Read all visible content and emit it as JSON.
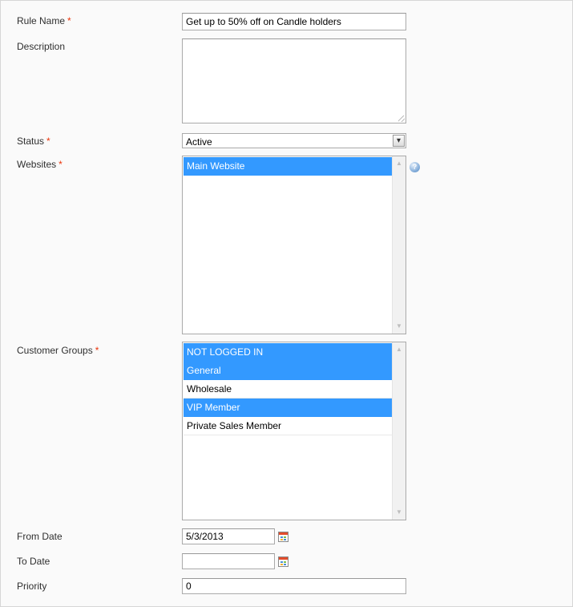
{
  "form": {
    "rule_name": {
      "label": "Rule Name",
      "required": "*",
      "value": "Get up to 50% off on Candle holders"
    },
    "description": {
      "label": "Description",
      "value": ""
    },
    "status": {
      "label": "Status",
      "required": "*",
      "value": "Active"
    },
    "websites": {
      "label": "Websites",
      "required": "*",
      "options": [
        {
          "label": "Main Website",
          "selected": true
        }
      ]
    },
    "customer_groups": {
      "label": "Customer Groups",
      "required": "*",
      "options": [
        {
          "label": "NOT LOGGED IN",
          "selected": true
        },
        {
          "label": "General",
          "selected": true
        },
        {
          "label": "Wholesale",
          "selected": false
        },
        {
          "label": "VIP Member",
          "selected": true
        },
        {
          "label": "Private Sales Member",
          "selected": false
        }
      ]
    },
    "from_date": {
      "label": "From Date",
      "value": "5/3/2013"
    },
    "to_date": {
      "label": "To Date",
      "value": ""
    },
    "priority": {
      "label": "Priority",
      "value": "0"
    }
  },
  "icons": {
    "help": "help-icon",
    "calendar": "calendar-icon",
    "select_arrow": "chevron-down-icon",
    "help_glyph": "?",
    "arrow_glyph": "▾",
    "scroll_up_glyph": "▲",
    "scroll_down_glyph": "▼"
  },
  "colors": {
    "required": "#eb340a",
    "selection": "#3399ff"
  }
}
